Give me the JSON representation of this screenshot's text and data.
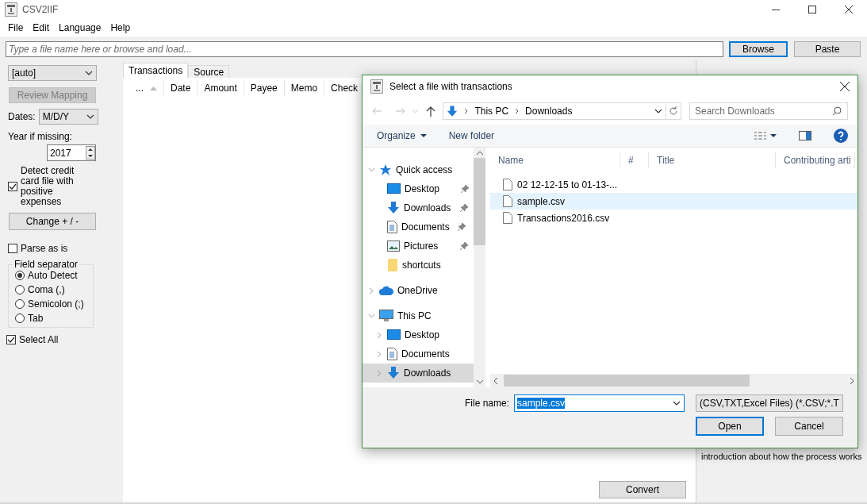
{
  "window": {
    "title": "CSV2IIF"
  },
  "menu": [
    "File",
    "Edit",
    "Language",
    "Help"
  ],
  "file_field": {
    "placeholder": "Type a file name here or browse and load..."
  },
  "top_buttons": [
    {
      "label": "Browse",
      "focused": true
    },
    {
      "label": "Paste",
      "focused": false
    }
  ],
  "left_panel": {
    "format_select": "[auto]",
    "review_button": {
      "label": "Review Mapping",
      "disabled": true
    },
    "dates": {
      "label": "Dates:",
      "value": "M/D/Y"
    },
    "year": {
      "label": "Year if missing:",
      "value": "2017"
    },
    "detect_credit": {
      "label": "Detect credit card file with positive expenses",
      "checked": true
    },
    "change_button": "Change + / -",
    "parse_as_is": {
      "label": "Parse as is",
      "checked": false
    },
    "field_separator": {
      "title": "Field separator",
      "options": [
        {
          "label": "Auto Detect",
          "selected": true
        },
        {
          "label": "Coma (,)",
          "selected": false
        },
        {
          "label": "Semicolon (;)",
          "selected": false
        },
        {
          "label": "Tab",
          "selected": false
        }
      ]
    },
    "select_all": {
      "label": "Select All",
      "checked": true
    }
  },
  "tabs": [
    {
      "label": "Transactions",
      "selected": true
    },
    {
      "label": "Source",
      "selected": false
    }
  ],
  "columns": [
    {
      "label": "...",
      "sorted": true
    },
    {
      "label": "Date",
      "sorted": false
    },
    {
      "label": "Amount",
      "sorted": false
    },
    {
      "label": "Payee",
      "sorted": false
    },
    {
      "label": "Memo",
      "sorted": false
    },
    {
      "label": "Check",
      "sorted": false
    }
  ],
  "convert_button": "Convert",
  "right_panel": {
    "text": "introduction about how the process works"
  },
  "dialog": {
    "title": "Select a file with transactions",
    "breadcrumb": [
      "This PC",
      "Downloads"
    ],
    "search": {
      "placeholder": "Search Downloads"
    },
    "toolbar": [
      {
        "label": "Organize",
        "dropdown": true
      },
      {
        "label": "New folder",
        "dropdown": false
      }
    ],
    "nav": [
      {
        "label": "Quick access",
        "kind": "star",
        "expanded": true,
        "selected": false,
        "children": [
          {
            "label": "Desktop",
            "kind": "desktop",
            "pinned": true,
            "selected": false
          },
          {
            "label": "Downloads",
            "kind": "download",
            "pinned": true,
            "selected": false
          },
          {
            "label": "Documents",
            "kind": "document",
            "pinned": true,
            "selected": false
          },
          {
            "label": "Pictures",
            "kind": "picture",
            "pinned": true,
            "selected": false
          },
          {
            "label": "shortcuts",
            "kind": "folder",
            "pinned": false,
            "selected": false
          }
        ]
      },
      {
        "label": "OneDrive",
        "kind": "cloud",
        "expanded": false,
        "selected": false
      },
      {
        "label": "This PC",
        "kind": "computer",
        "expanded": true,
        "selected": false,
        "children": [
          {
            "label": "Desktop",
            "kind": "desktop",
            "expanded": false,
            "selected": false
          },
          {
            "label": "Documents",
            "kind": "document",
            "expanded": false,
            "selected": false
          },
          {
            "label": "Downloads",
            "kind": "download",
            "expanded": false,
            "selected": true
          }
        ]
      }
    ],
    "columns": [
      "Name",
      "#",
      "Title",
      "Contributing arti"
    ],
    "files": [
      {
        "name": "02 12-12-15 to 01-13-...",
        "selected": false
      },
      {
        "name": "sample.csv",
        "selected": true
      },
      {
        "name": "Transactions2016.csv",
        "selected": false
      }
    ],
    "file_name": {
      "label": "File name:",
      "value": "sample.csv"
    },
    "file_type": "(CSV,TXT,Excel Files) (*.CSV;*.T",
    "buttons": [
      {
        "label": "Open",
        "default": true
      },
      {
        "label": "Cancel",
        "default": false
      }
    ]
  }
}
